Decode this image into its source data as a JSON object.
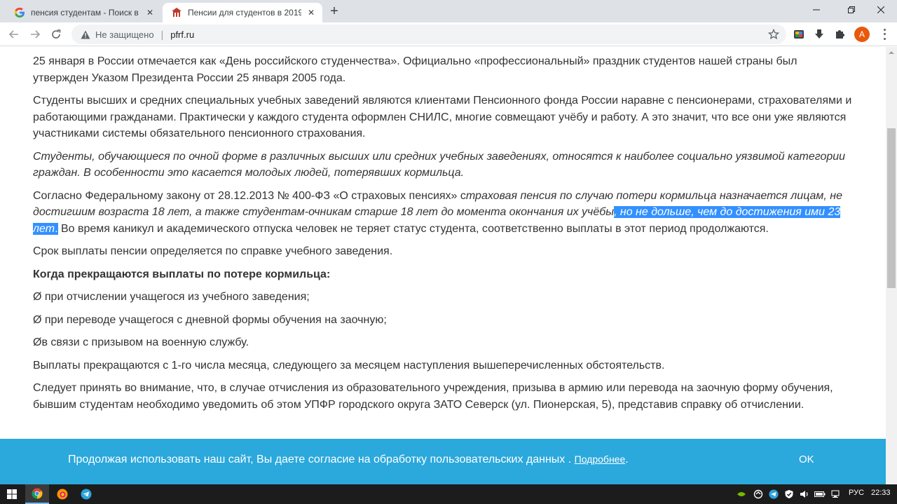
{
  "browser": {
    "tabs": [
      {
        "title": "пенсия студентам - Поиск в Goo",
        "favicon": "google-g-icon"
      },
      {
        "title": "Пенсии для студентов в 2019 го",
        "favicon": "pfrf-logo-icon"
      }
    ],
    "omnibox": {
      "security_label": "Не защищено",
      "url": "pfrf.ru"
    },
    "avatar_letter": "A"
  },
  "article": {
    "p1": "25 января в России отмечается как «День российского студенчества». Официально «профессиональный» праздник студентов нашей страны был утвержден Указом Президента России 25 января 2005 года.",
    "p2": "Студенты высших и средних специальных учебных заведений являются клиентами Пенсионного фонда России наравне с пенсионерами, страхователями и работающими гражданами. Практически у каждого студента оформлен СНИЛС, многие совмещают учёбу и работу. А это значит, что все они уже являются участниками системы обязательного пенсионного страхования.",
    "p3": "Студенты, обучающиеся по очной форме в различных высших или средних учебных заведениях, относятся к наиболее социально уязвимой категории граждан. В особенности это касается молодых людей, потерявших кормильца.",
    "p4_start": "Согласно Федеральному закону от 28.12.2013 № 400-ФЗ «О страховых пенсиях» с",
    "p4_italic": "траховая пенсия по случаю потери кормильца назначается лицам, не достигшим возраста 18 лет, а также студентам-очникам старше 18 лет до момента окончания их учёбы",
    "p4_highlight": ", но не дольше, чем до достижения ими 23 лет",
    "p4_highlight_end": ".",
    "p4_end": " Во время каникул и академического отпуска человек не теряет статус студента, соответственно выплаты в этот период продолжаются.",
    "p5": "Срок выплаты пенсии определяется по справке учебного заведения.",
    "p6": "Когда прекращаются выплаты по потере кормильца:",
    "p7": "Ø при отчислении учащегося из учебного заведения;",
    "p8": "Ø при переводе учащегося с дневной формы обучения на заочную;",
    "p9": "Øв связи с призывом на военную службу.",
    "p10": "Выплаты прекращаются с 1-го числа месяца, следующего за месяцем наступления вышеперечисленных обстоятельств.",
    "p11": "Следует принять во внимание, что, в случае отчисления из образовательного учреждения, призыва в армию или перевода на заочную форму обучения, бывшим студентам необходимо уведомить об этом УПФР городского округа ЗАТО Северск (ул. Пионерская, 5), представив справку об отчислении."
  },
  "cookie_banner": {
    "message": "Продолжая использовать наш сайт, Вы даете согласие на обработку пользовательских данных .",
    "more_link": "Подробнее",
    "more_suffix": ".",
    "ok_label": "OK"
  },
  "taskbar": {
    "language": "РУС",
    "time": "22:33"
  },
  "colors": {
    "selection": "#3390ff",
    "banner": "#2ba8dc",
    "avatar": "#e8590c"
  }
}
